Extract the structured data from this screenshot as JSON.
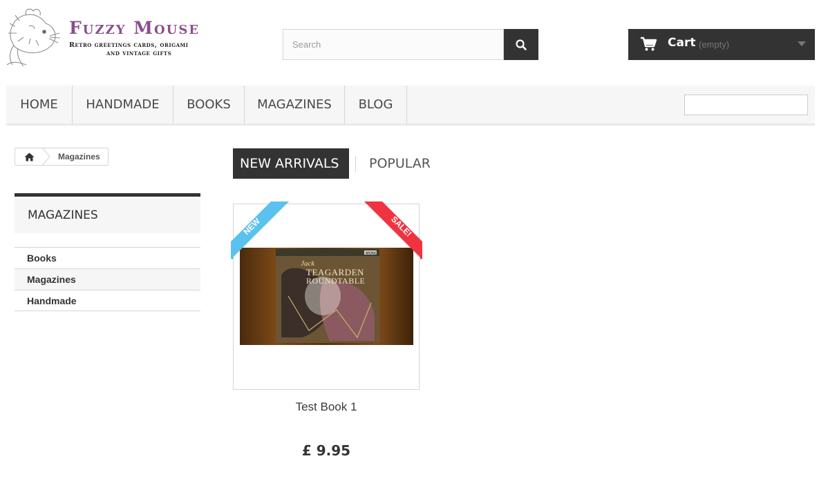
{
  "header": {
    "logo": {
      "brand": "Fuzzy Mouse",
      "tagline_1": "Retro greetings cards, origami",
      "tagline_2": "and vintage gifts",
      "icon": "mouse-logo-icon"
    },
    "search": {
      "placeholder": "Search",
      "icon": "search-icon"
    },
    "cart": {
      "label": "Cart",
      "status": "(empty)",
      "icon": "shopping-cart-icon"
    }
  },
  "nav": {
    "items": [
      {
        "label": "HOME"
      },
      {
        "label": "HANDMADE"
      },
      {
        "label": "BOOKS"
      },
      {
        "label": "MAGAZINES"
      },
      {
        "label": "BLOG"
      }
    ]
  },
  "breadcrumb": {
    "home_icon": "home-icon",
    "current": "Magazines"
  },
  "sidebar": {
    "title": "MAGAZINES",
    "items": [
      {
        "label": "Books"
      },
      {
        "label": "Magazines"
      },
      {
        "label": "Handmade"
      }
    ]
  },
  "tabs": {
    "new_arrivals": "NEW ARRIVALS",
    "popular": "POPULAR"
  },
  "product": {
    "name": "Test Book 1",
    "price": "£ 9.95",
    "badge_new": "NEW",
    "badge_sale": "SALE!",
    "cover_text": "Jack Teagarden Roundtable",
    "cover_mono": "MONO"
  },
  "colors": {
    "brand_purple": "#8a4f8c",
    "dark": "#333333",
    "ribbon_new": "#5bc2f0",
    "ribbon_sale": "#f13340"
  }
}
